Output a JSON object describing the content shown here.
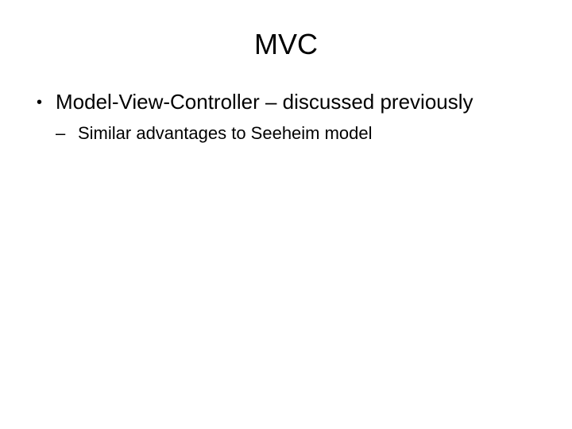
{
  "slide": {
    "title": "MVC",
    "bullets": [
      {
        "level": 1,
        "text": "Model-View-Controller – discussed previously"
      },
      {
        "level": 2,
        "text": "Similar advantages to Seeheim model"
      }
    ]
  }
}
